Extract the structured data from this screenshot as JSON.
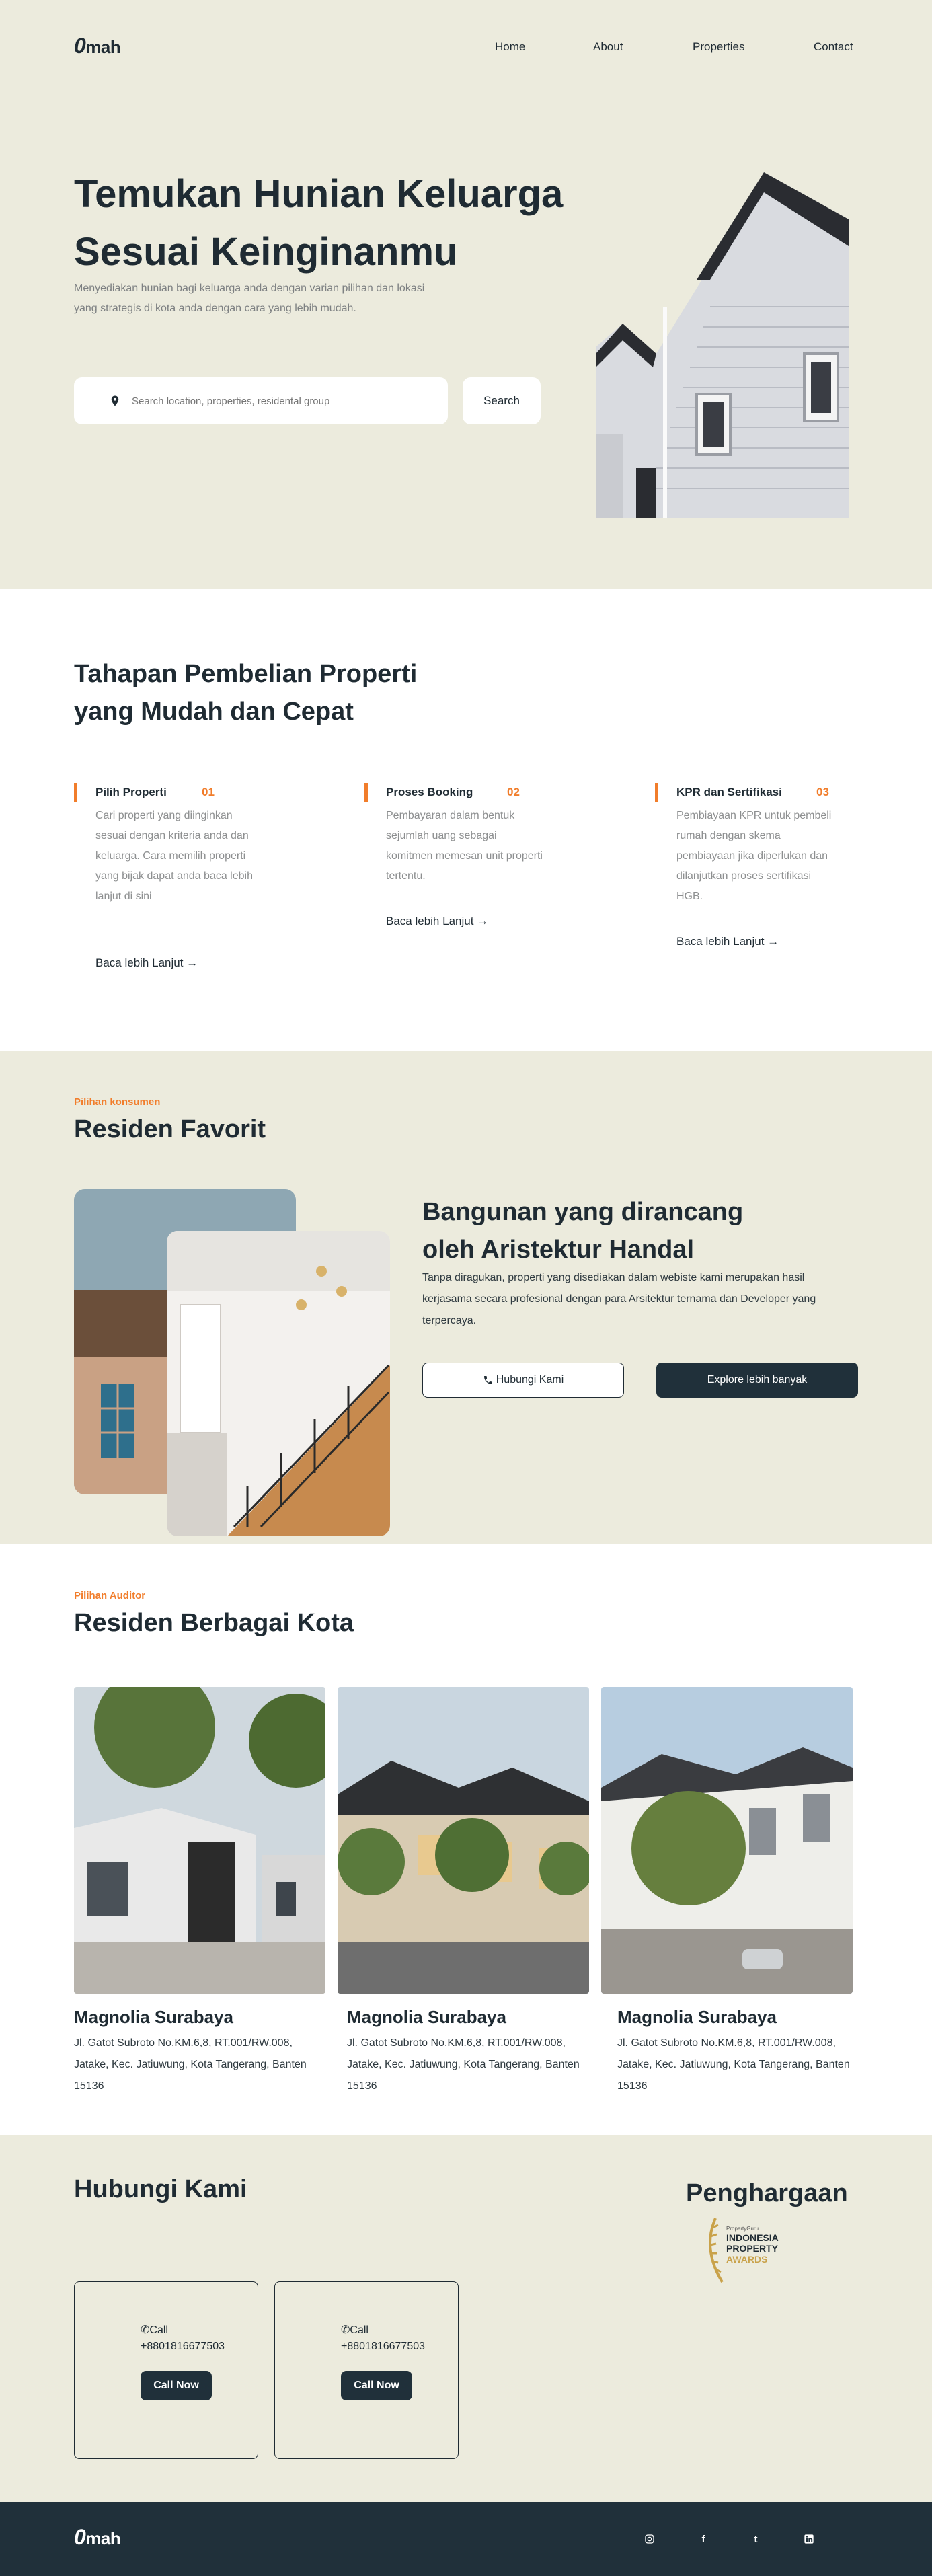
{
  "brand": {
    "logo_o": "0",
    "logo_rest": "mah"
  },
  "nav": {
    "home": "Home",
    "about": "About",
    "properties": "Properties",
    "contact": "Contact"
  },
  "hero": {
    "title_line1": "Temukan Hunian Keluarga",
    "title_line2": "Sesuai Keinginanmu",
    "subtitle": "Menyediakan hunian bagi keluarga anda dengan varian pilihan dan lokasi yang strategis di kota anda dengan cara yang lebih mudah.",
    "search_placeholder": "Search location, properties, residental group",
    "search_button": "Search"
  },
  "steps": {
    "title_line1": "Tahapan Pembelian Properti",
    "title_line2": "yang Mudah dan Cepat",
    "items": [
      {
        "name": "Pilih Properti",
        "num": "01",
        "desc": "Cari properti yang diinginkan sesuai dengan kriteria anda dan keluarga. Cara memilih properti yang bijak dapat anda baca lebih lanjut di sini",
        "more": "Baca lebih Lanjut"
      },
      {
        "name": "Proses Booking",
        "num": "02",
        "desc": "Pembayaran dalam bentuk sejumlah uang sebagai komitmen memesan unit properti tertentu.",
        "more": "Baca lebih Lanjut"
      },
      {
        "name": "KPR dan Sertifikasi",
        "num": "03",
        "desc": "Pembiayaan KPR untuk pembeli rumah dengan skema pembiayaan jika diperlukan dan dilanjutkan proses sertifikasi HGB.",
        "more": "Baca lebih Lanjut"
      }
    ]
  },
  "favorit": {
    "eyebrow": "Pilihan konsumen",
    "title": "Residen Favorit",
    "heading_line1": "Bangunan yang dirancang",
    "heading_line2": "oleh Aristektur Handal",
    "text": "Tanpa diragukan, properti yang disediakan dalam webiste kami merupakan hasil kerjasama secara profesional dengan para Arsitektur ternama dan Developer yang terpercaya.",
    "btn_contact": "Hubungi Kami",
    "btn_explore": "Explore lebih banyak"
  },
  "cities": {
    "eyebrow": "Pilihan Auditor",
    "title": "Residen Berbagai Kota",
    "items": [
      {
        "name": "Magnolia Surabaya",
        "addr": "Jl. Gatot Subroto No.KM.6,8, RT.001/RW.008, Jatake, Kec. Jatiuwung, Kota Tangerang, Banten 15136"
      },
      {
        "name": "Magnolia Surabaya",
        "addr": "Jl. Gatot Subroto No.KM.6,8, RT.001/RW.008, Jatake, Kec. Jatiuwung, Kota Tangerang, Banten 15136"
      },
      {
        "name": "Magnolia Surabaya",
        "addr": "Jl. Gatot Subroto No.KM.6,8, RT.001/RW.008, Jatake, Kec. Jatiuwung, Kota Tangerang, Banten 15136"
      }
    ]
  },
  "contact": {
    "title": "Hubungi Kami",
    "cards": [
      {
        "label": "Call",
        "phone": "+8801816677503",
        "btn": "Call Now"
      },
      {
        "label": "Call",
        "phone": "+8801816677503",
        "btn": "Call Now"
      }
    ],
    "award_title": "Penghargaan",
    "award_logo_text": [
      "PropertyGuru",
      "INDONESIA",
      "PROPERTY",
      "AWARDS"
    ]
  },
  "footer": {
    "social": [
      "instagram",
      "facebook",
      "twitter",
      "linkedin"
    ]
  },
  "colors": {
    "accent": "#f17d2b",
    "dark": "#20303a",
    "beige": "#ecebdd"
  }
}
